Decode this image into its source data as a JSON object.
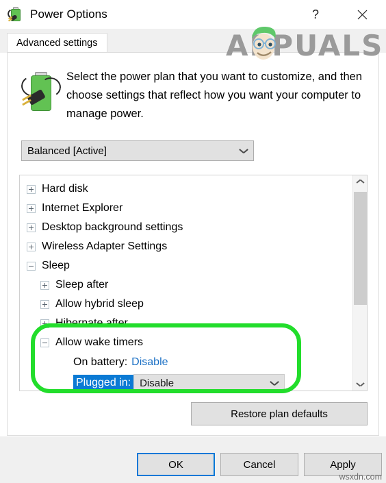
{
  "window": {
    "title": "Power Options",
    "icon": "power-plan-battery-icon",
    "help_label": "?",
    "close_label": "✕"
  },
  "tabs": [
    {
      "label": "Advanced settings",
      "active": true
    }
  ],
  "description": {
    "icon": "battery-plug-icon",
    "text": "Select the power plan that you want to customize, and then choose settings that reflect how you want your computer to manage power."
  },
  "plan_selector": {
    "value": "Balanced [Active]",
    "chevron": "chevron-down-icon"
  },
  "settings_tree": [
    {
      "label": "Hard disk",
      "level": 0,
      "state": "collapsed"
    },
    {
      "label": "Internet Explorer",
      "level": 0,
      "state": "collapsed"
    },
    {
      "label": "Desktop background settings",
      "level": 0,
      "state": "collapsed"
    },
    {
      "label": "Wireless Adapter Settings",
      "level": 0,
      "state": "collapsed"
    },
    {
      "label": "Sleep",
      "level": 0,
      "state": "expanded"
    },
    {
      "label": "Sleep after",
      "level": 1,
      "state": "collapsed"
    },
    {
      "label": "Allow hybrid sleep",
      "level": 1,
      "state": "collapsed"
    },
    {
      "label": "Hibernate after",
      "level": 1,
      "state": "collapsed"
    },
    {
      "label": "Allow wake timers",
      "level": 1,
      "state": "expanded"
    }
  ],
  "wake_timer_settings": {
    "on_battery": {
      "key": "On battery:",
      "value": "Disable"
    },
    "plugged_in": {
      "key": "Plugged in:",
      "value": "Disable",
      "selected": true
    }
  },
  "highlight": {
    "color": "#22dd2b",
    "target": "allow-wake-timers-section"
  },
  "scrollbar": {
    "up_arrow": "chevron-up-icon",
    "down_arrow": "chevron-down-icon"
  },
  "buttons": {
    "restore": "Restore plan defaults",
    "ok": "OK",
    "cancel": "Cancel",
    "apply": "Apply"
  },
  "watermarks": {
    "brand": "PPUALS",
    "brand_full": "APPUALS",
    "source": "wsxdn.com"
  },
  "colors": {
    "accent": "#0078d7",
    "selection": "#0b7ad4",
    "link": "#1a6fc4",
    "highlight_green": "#22dd2b",
    "dialog_bg": "#f0f0f0",
    "button_face": "#e1e1e1"
  }
}
